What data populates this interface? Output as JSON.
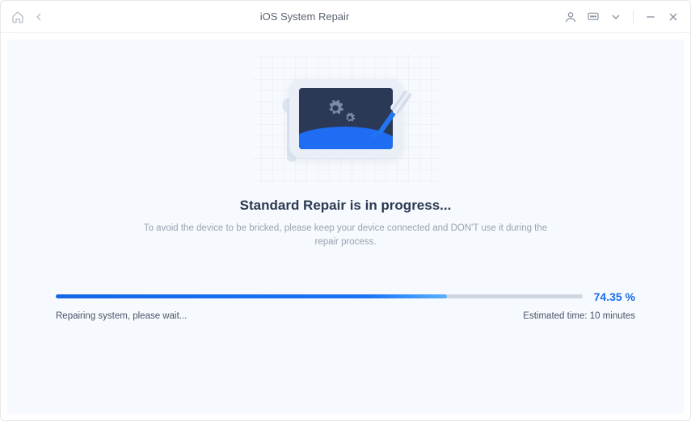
{
  "titlebar": {
    "title": "iOS System Repair"
  },
  "main": {
    "heading": "Standard Repair is in progress...",
    "subtext": "To avoid the device to be bricked, please keep your device connected and DON'T use it during the repair process."
  },
  "progress": {
    "percent_value": 74.35,
    "percent_label": "74.35 %",
    "fill_width": "74.35%",
    "status_left": "Repairing system, please wait...",
    "status_right": "Estimated time: 10 minutes"
  },
  "colors": {
    "accent": "#1a6de8",
    "heading": "#2c3a52",
    "muted": "#9aa3b2"
  }
}
